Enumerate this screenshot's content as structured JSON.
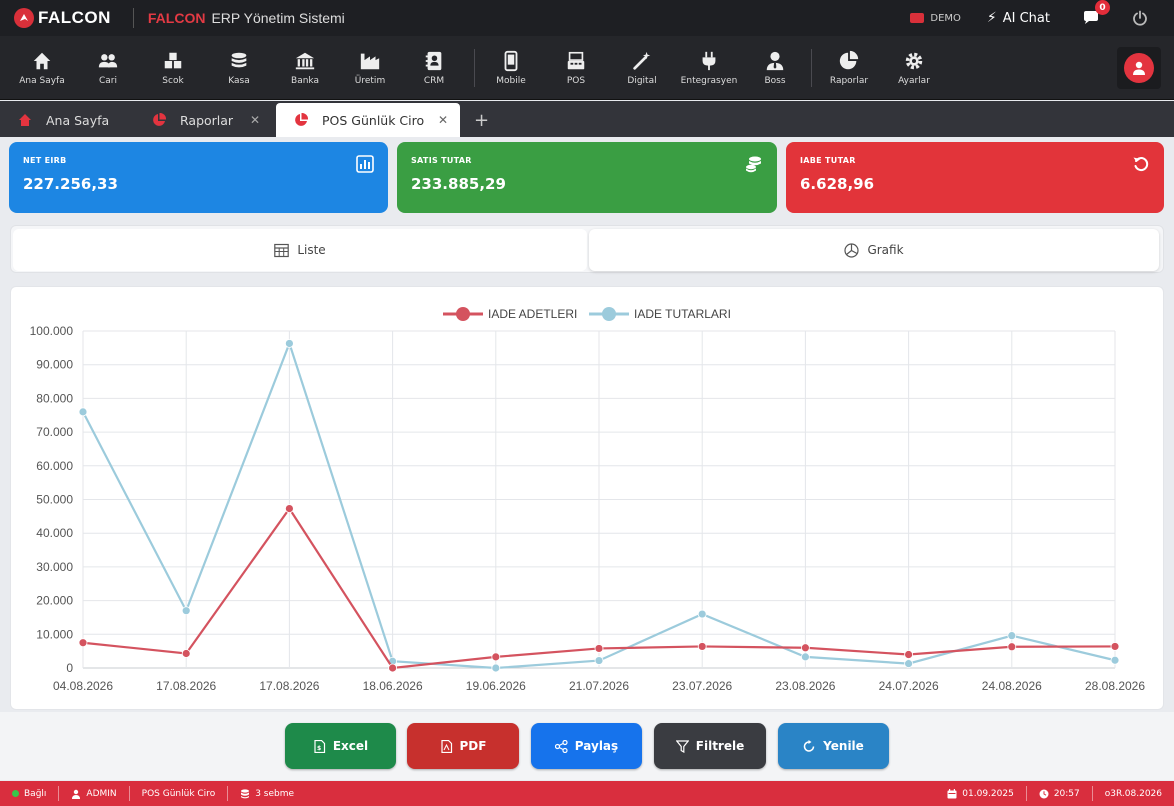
{
  "titlebar": {
    "logo": "FALCON",
    "brand": "FALCON",
    "subtitle": "ERP Yönetim Sistemi",
    "demo": "DEMO",
    "ai_chat": "AI Chat",
    "notification_count": "0"
  },
  "toolbar": {
    "items": [
      {
        "label": "Ana Sayfa",
        "icon": "home-icon"
      },
      {
        "label": "Cari",
        "icon": "users-icon"
      },
      {
        "label": "Scok",
        "icon": "boxes-icon"
      },
      {
        "label": "Kasa",
        "icon": "coins-icon"
      },
      {
        "label": "Banka",
        "icon": "bank-icon"
      },
      {
        "label": "Üretim",
        "icon": "factory-icon"
      },
      {
        "label": "CRM",
        "icon": "contacts-icon"
      },
      {
        "label": "Mobile",
        "icon": "mobile-icon"
      },
      {
        "label": "POS",
        "icon": "pos-icon"
      },
      {
        "label": "Digital",
        "icon": "magic-wand-icon"
      },
      {
        "label": "Entegrasyen",
        "icon": "plug-icon"
      },
      {
        "label": "Boss",
        "icon": "user-tie-icon"
      },
      {
        "label": "Raporlar",
        "icon": "pie-chart-icon"
      },
      {
        "label": "Ayarlar",
        "icon": "gear-icon"
      }
    ]
  },
  "tabs": [
    {
      "label": "Ana Sayfa",
      "closable": false
    },
    {
      "label": "Raporlar",
      "closable": true
    },
    {
      "label": "POS Günlük Ciro",
      "closable": true,
      "active": true
    }
  ],
  "stats": {
    "net": {
      "label": "NET EIRB",
      "value": "227.256,33"
    },
    "sales": {
      "label": "SATIS TUTAR",
      "value": "233.885,29"
    },
    "returns": {
      "label": "IABE TUTAR",
      "value": "6.628,96"
    }
  },
  "view_toggle": {
    "list": "Liste",
    "chart": "Grafik",
    "selected": "Grafik"
  },
  "chart_data": {
    "type": "line",
    "categories": [
      "04.08.2026",
      "17.08.2026",
      "17.08.2026",
      "18.06.2026",
      "19.06.2026",
      "21.07.2026",
      "23.07.2026",
      "23.08.2026",
      "24.07.2026",
      "24.08.2026",
      "28.08.2026"
    ],
    "series": [
      {
        "name": "IADE ADETLERI",
        "color": "#d4535f",
        "values": [
          7500,
          4300,
          47300,
          0,
          3300,
          5800,
          6400,
          6000,
          4000,
          6300,
          6400
        ]
      },
      {
        "name": "IADE TUTARLARI",
        "color": "#9ccbdc",
        "values": [
          76000,
          17000,
          96300,
          2000,
          0,
          2200,
          16000,
          3300,
          1300,
          9600,
          2300
        ]
      }
    ],
    "ylim": [
      0,
      100000
    ],
    "yticks": [
      "0",
      "10.000",
      "20.000",
      "30.000",
      "40.000",
      "50.000",
      "60.000",
      "70.000",
      "80.000",
      "90.000",
      "100.000"
    ],
    "grid": true,
    "legend": "top-center"
  },
  "actions": {
    "excel": "Excel",
    "pdf": "PDF",
    "share": "Paylaş",
    "filter": "Filtrele",
    "refresh": "Yenile"
  },
  "status": {
    "connection": "Bağlı",
    "user": "ADMIN",
    "page": "POS Günlük Ciro",
    "branch": "3 sebme",
    "date": "01.09.2025",
    "time": "20:57",
    "period": "o3R.08.2026"
  }
}
